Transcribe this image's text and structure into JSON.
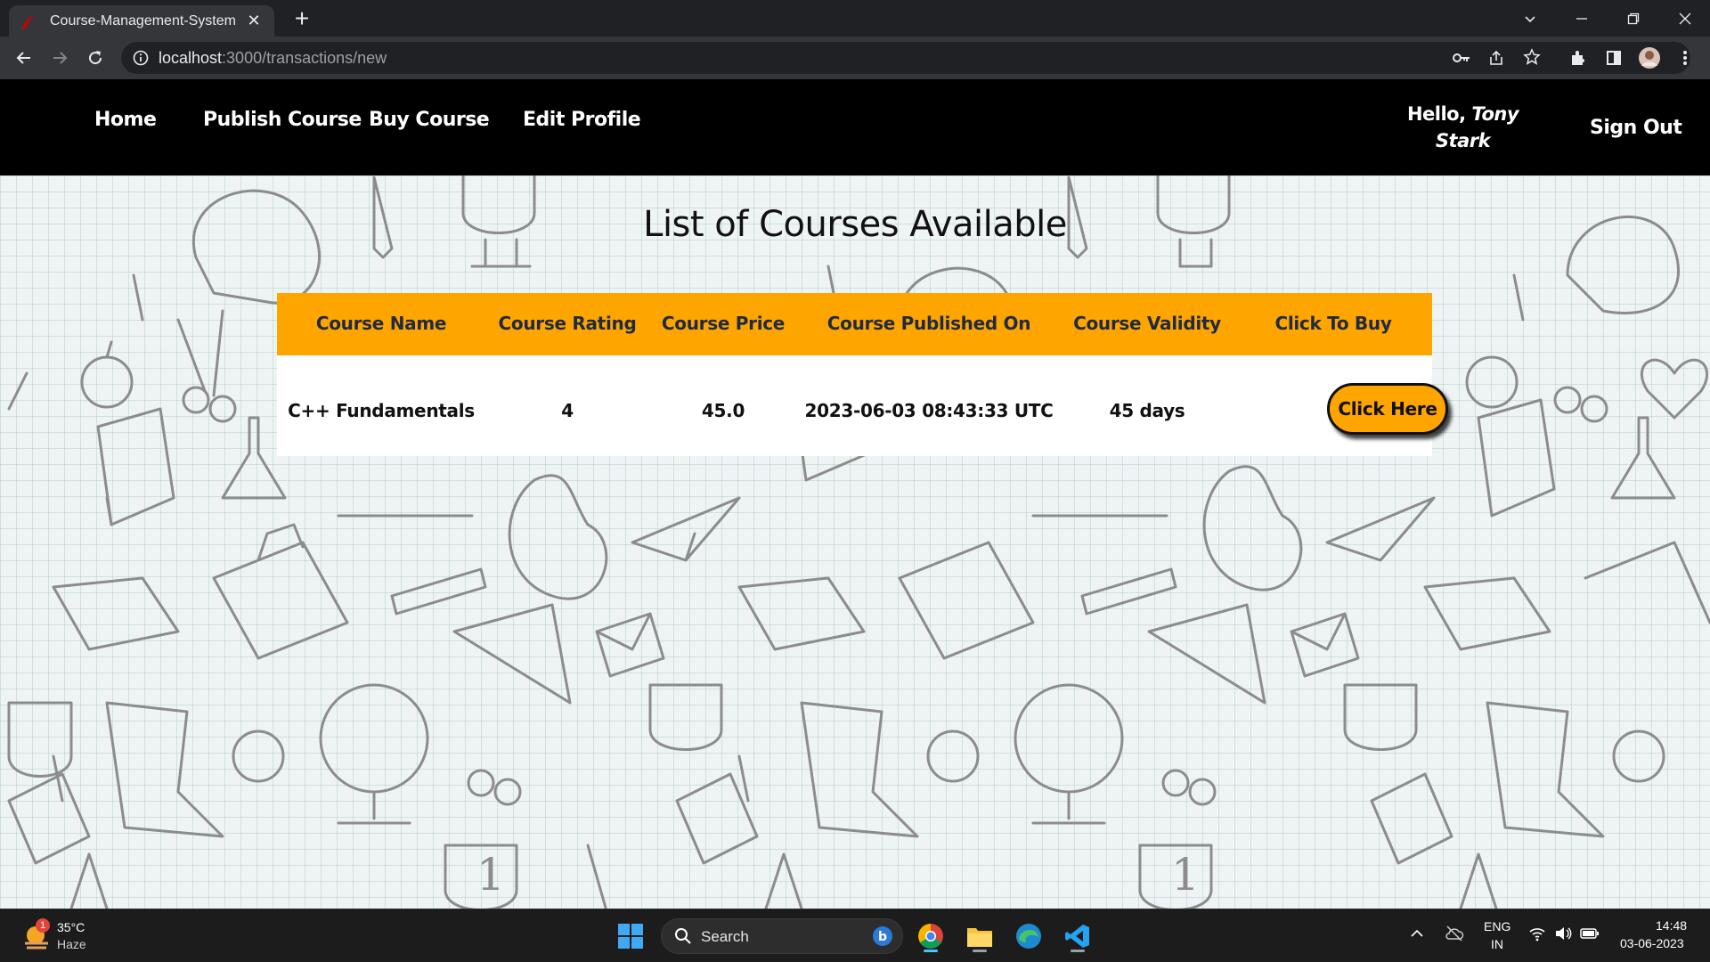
{
  "browser": {
    "tab_title": "Course-Management-System",
    "url_host": "localhost",
    "url_rest": ":3000/transactions/new"
  },
  "nav": {
    "home": "Home",
    "publish": "Publish Course",
    "buy": "Buy Course",
    "edit": "Edit Profile",
    "hello_prefix": "Hello,",
    "user_first": "Tony",
    "user_last": "Stark",
    "signout": "Sign Out"
  },
  "page": {
    "title": "List of Courses Available"
  },
  "table": {
    "headers": [
      "Course Name",
      "Course Rating",
      "Course Price",
      "Course Published On",
      "Course Validity",
      "Click To Buy"
    ],
    "rows": [
      {
        "name": "C++ Fundamentals",
        "rating": "4",
        "price": "45.0",
        "published": "2023-06-03 08:43:33 UTC",
        "validity": "45 days",
        "action": "Click Here"
      }
    ]
  },
  "taskbar": {
    "weather_temp": "35°C",
    "weather_desc": "Haze",
    "weather_badge": "1",
    "search_label": "Search",
    "lang_1": "ENG",
    "lang_2": "IN",
    "time": "14:48",
    "date": "03-06-2023"
  },
  "colors": {
    "accent": "#ffa500",
    "navbar": "#000000",
    "header_text": "#1f2a44"
  }
}
